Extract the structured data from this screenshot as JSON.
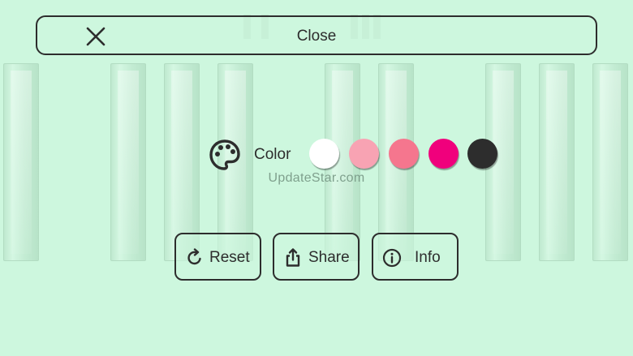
{
  "header": {
    "close_label": "Close",
    "close_icon": "close-x-icon"
  },
  "color": {
    "label": "Color",
    "icon": "palette-icon",
    "swatches": [
      "#ffffff",
      "#f8a3b3",
      "#f5768e",
      "#f0007c",
      "#2d2d2d"
    ]
  },
  "watermark": "UpdateStar.com",
  "buttons": {
    "reset": {
      "label": "Reset",
      "icon": "rotate-icon"
    },
    "share": {
      "label": "Share",
      "icon": "share-icon"
    },
    "info": {
      "label": "Info",
      "icon": "info-icon"
    }
  }
}
